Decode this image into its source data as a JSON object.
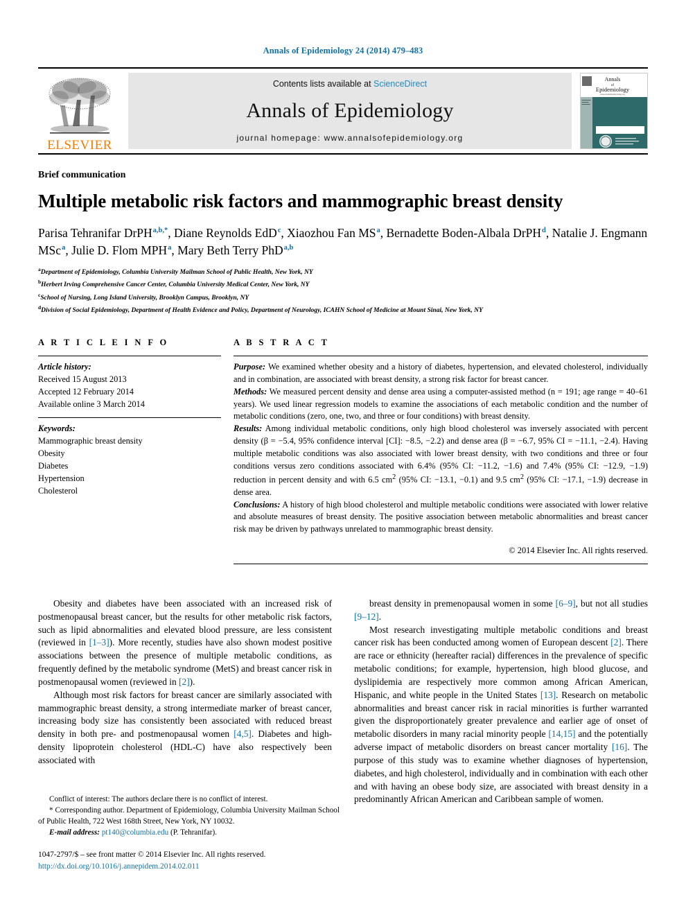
{
  "running_head": "Annals of Epidemiology 24 (2014) 479–483",
  "masthead": {
    "publisher_name": "ELSEVIER",
    "contents_prefix": "Contents lists available at ",
    "contents_link": "ScienceDirect",
    "journal_name": "Annals of Epidemiology",
    "homepage": "journal homepage: www.annalsofepidemiology.org",
    "cover_title_line1": "Annals",
    "cover_title_line2": "of",
    "cover_title_line3": "Epidemiology",
    "cover_subtitle": "www.annalsofepidemiology.org"
  },
  "article": {
    "doctype": "Brief communication",
    "title": "Multiple metabolic risk factors and mammographic breast density",
    "authors": [
      {
        "name": "Parisa Tehranifar DrPH",
        "marks": "a,b,*",
        "sep": ", "
      },
      {
        "name": "Diane Reynolds EdD",
        "marks": "c",
        "sep": ", "
      },
      {
        "name": "Xiaozhou Fan MS",
        "marks": "a",
        "sep": ", "
      },
      {
        "name": "Bernadette Boden-Albala DrPH",
        "marks": "d",
        "sep": ", "
      },
      {
        "name": "Natalie J. Engmann MSc",
        "marks": "a",
        "sep": ", "
      },
      {
        "name": "Julie D. Flom MPH",
        "marks": "a",
        "sep": ", "
      },
      {
        "name": "Mary Beth Terry PhD",
        "marks": "a,b",
        "sep": ""
      }
    ],
    "affiliations": [
      {
        "mark": "a",
        "text": "Department of Epidemiology, Columbia University Mailman School of Public Health, New York, NY"
      },
      {
        "mark": "b",
        "text": "Herbert Irving Comprehensive Cancer Center, Columbia University Medical Center, New York, NY"
      },
      {
        "mark": "c",
        "text": "School of Nursing, Long Island University, Brooklyn Campus, Brooklyn, NY"
      },
      {
        "mark": "d",
        "text": "Division of Social Epidemiology, Department of Health Evidence and Policy, Department of Neurology, ICAHN School of Medicine at Mount Sinai, New York, NY"
      }
    ]
  },
  "article_info": {
    "heading": "A R T I C L E   I N F O",
    "history_label": "Article history:",
    "history": [
      "Received 15 August 2013",
      "Accepted 12 February 2014",
      "Available online 3 March 2014"
    ],
    "keywords_label": "Keywords:",
    "keywords": [
      "Mammographic breast density",
      "Obesity",
      "Diabetes",
      "Hypertension",
      "Cholesterol"
    ]
  },
  "abstract": {
    "heading": "A B S T R A C T",
    "purpose_label": "Purpose:",
    "purpose": " We examined whether obesity and a history of diabetes, hypertension, and elevated cholesterol, individually and in combination, are associated with breast density, a strong risk factor for breast cancer.",
    "methods_label": "Methods:",
    "methods": " We measured percent density and dense area using a computer-assisted method (n = 191; age range = 40–61 years). We used linear regression models to examine the associations of each metabolic condition and the number of metabolic conditions (zero, one, two, and three or four conditions) with breast density.",
    "results_label": "Results:",
    "results": " Among individual metabolic conditions, only high blood cholesterol was inversely associated with percent density (β = −5.4, 95% confidence interval [CI]: −8.5, −2.2) and dense area (β = −6.7, 95% CI = −11.1, −2.4). Having multiple metabolic conditions was also associated with lower breast density, with two conditions and three or four conditions versus zero conditions associated with 6.4% (95% CI: −11.2, −1.6) and 7.4% (95% CI: −12.9, −1.9) reduction in percent density and with 6.5 cm2 (95% CI: −13.1, −0.1) and 9.5 cm2 (95% CI: −17.1, −1.9) decrease in dense area.",
    "conclusions_label": "Conclusions:",
    "conclusions": " A history of high blood cholesterol and multiple metabolic conditions were associated with lower relative and absolute measures of breast density. The positive association between metabolic abnormalities and breast cancer risk may be driven by pathways unrelated to mammographic breast density.",
    "copyright": "© 2014 Elsevier Inc. All rights reserved."
  },
  "body": {
    "left": [
      "Obesity and diabetes have been associated with an increased risk of postmenopausal breast cancer, but the results for other metabolic risk factors, such as lipid abnormalities and elevated blood pressure, are less consistent (reviewed in [1–3]). More recently, studies have also shown modest positive associations between the presence of multiple metabolic conditions, as frequently defined by the metabolic syndrome (MetS) and breast cancer risk in postmenopausal women (reviewed in [2]).",
      "Although most risk factors for breast cancer are similarly associated with mammographic breast density, a strong intermediate marker of breast cancer, increasing body size has consistently been associated with reduced breast density in both pre- and postmenopausal women [4,5]. Diabetes and high-density lipoprotein cholesterol (HDL-C) have also respectively been associated with"
    ],
    "right": [
      "breast density in premenopausal women in some [6–9], but not all studies [9–12].",
      "Most research investigating multiple metabolic conditions and breast cancer risk has been conducted among women of European descent [2]. There are race or ethnicity (hereafter racial) differences in the prevalence of specific metabolic conditions; for example, hypertension, high blood glucose, and dyslipidemia are respectively more common among African American, Hispanic, and white people in the United States [13]. Research on metabolic abnormalities and breast cancer risk in racial minorities is further warranted given the disproportionately greater prevalence and earlier age of onset of metabolic disorders in many racial minority people [14,15] and the potentially adverse impact of metabolic disorders on breast cancer mortality [16]. The purpose of this study was to examine whether diagnoses of hypertension, diabetes, and high cholesterol, individually and in combination with each other and with having an obese body size, are associated with breast density in a predominantly African American and Caribbean sample of women."
    ]
  },
  "footnotes": {
    "conflict": "Conflict of interest: The authors declare there is no conflict of interest.",
    "corresponding": "* Corresponding author. Department of Epidemiology, Columbia University Mailman School of Public Health, 722 West 168th Street, New York, NY 10032.",
    "email_label": "E-mail address:",
    "email": "pt140@columbia.edu",
    "email_attrib": " (P. Tehranifar).",
    "issn_line": "1047-2797/$ – see front matter © 2014 Elsevier Inc. All rights reserved.",
    "doi": "http://dx.doi.org/10.1016/j.annepidem.2014.02.011"
  },
  "colors": {
    "link_blue": "#1270a8",
    "sciencedirect_blue": "#1f8ac0",
    "elsevier_orange": "#f07d00",
    "band_gray": "#e6e6e6",
    "cover_teal": "#2f6a6a"
  }
}
